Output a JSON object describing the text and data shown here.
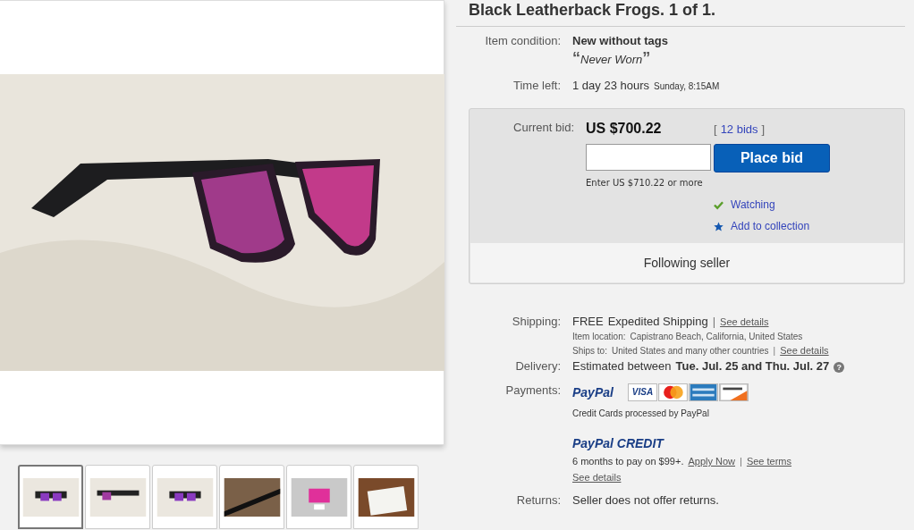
{
  "title": "Black Leatherback Frogs. 1 of 1.",
  "condition": {
    "label": "Item condition:",
    "value": "New without tags",
    "open_quote": "“",
    "note": "Never Worn",
    "close_quote": "”"
  },
  "time_left": {
    "label": "Time left:",
    "value": "1 day 23 hours",
    "detail": "Sunday, 8:15AM"
  },
  "bid_box": {
    "label": "Current bid:",
    "price": "US $700.22",
    "bid_open": "[",
    "bids": "12 bids",
    "bid_close": "]",
    "button": "Place bid",
    "hint": "Enter US $710.22 or more",
    "actions": [
      {
        "kind": "check",
        "label": "Watching"
      },
      {
        "kind": "star",
        "label": "Add to collection"
      }
    ],
    "footer": "Following seller"
  },
  "shipping": {
    "label": "Shipping:",
    "free": "FREE",
    "service": "Expedited Shipping",
    "separator": "|",
    "link": "See details",
    "location_label": "Item location:",
    "location": "Capistrano Beach, California, United States",
    "ships_label": "Ships to:",
    "ships": "United States and many other countries",
    "ships_separator": "|",
    "ships_link": "See details"
  },
  "delivery": {
    "label": "Delivery:",
    "prefix": "Estimated between",
    "dates": "Tue. Jul. 25 and Thu. Jul. 27",
    "help": "?"
  },
  "payments": {
    "label": "Payments:",
    "paypal": "PayPal",
    "cards": [
      {
        "kind": "visa",
        "text": "VISA"
      },
      {
        "kind": "mastercard"
      },
      {
        "kind": "amex"
      },
      {
        "kind": "discover"
      }
    ],
    "note": "Credit Cards processed by PayPal",
    "credit_logo": "PayPal CREDIT",
    "credit_text": "6 months to pay on $99+.",
    "apply": "Apply Now",
    "separator": "|",
    "terms": "See terms",
    "details": "See details"
  },
  "returns": {
    "label": "Returns:",
    "value": "Seller does not offer returns."
  },
  "thumbnails": [
    {
      "kind": "front",
      "selected": true
    },
    {
      "kind": "side",
      "selected": false
    },
    {
      "kind": "front",
      "selected": false
    },
    {
      "kind": "arm",
      "selected": false
    },
    {
      "kind": "pouch",
      "selected": false
    },
    {
      "kind": "card",
      "selected": false
    }
  ]
}
